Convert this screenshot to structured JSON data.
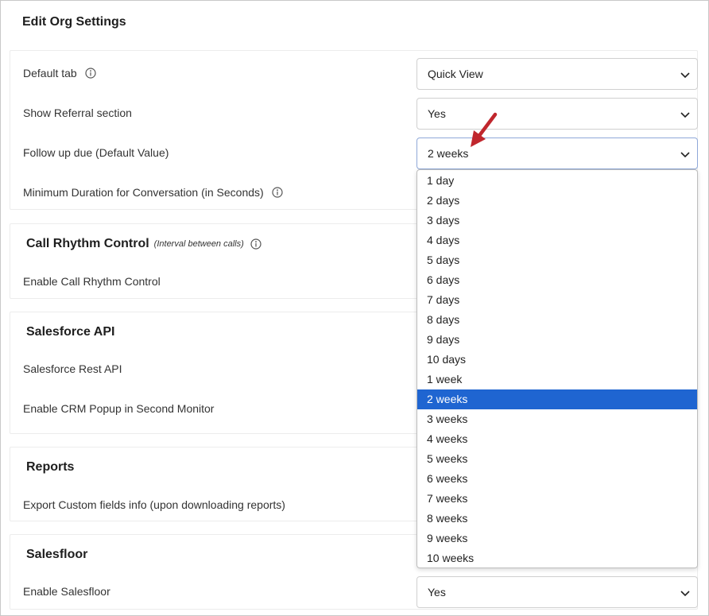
{
  "page": {
    "title": "Edit Org Settings"
  },
  "general": {
    "default_tab": {
      "label": "Default tab",
      "value": "Quick View"
    },
    "referral": {
      "label": "Show Referral section",
      "value": "Yes"
    },
    "follow_up": {
      "label": "Follow up due (Default Value)",
      "value": "2 weeks"
    },
    "min_duration": {
      "label": "Minimum Duration for Conversation (in Seconds)"
    }
  },
  "call_rhythm": {
    "heading": "Call Rhythm Control",
    "subheading": "(Interval between calls)",
    "enable_label": "Enable Call Rhythm Control"
  },
  "salesforce": {
    "heading": "Salesforce API",
    "rest_label": "Salesforce Rest API",
    "crm_popup_label": "Enable CRM Popup in Second Monitor"
  },
  "reports": {
    "heading": "Reports",
    "export_label": "Export Custom fields info (upon downloading reports)"
  },
  "salesfloor": {
    "heading": "Salesfloor",
    "enable_label": "Enable Salesfloor",
    "enable_value": "Yes"
  },
  "follow_up_options": [
    "1 day",
    "2 days",
    "3 days",
    "4 days",
    "5 days",
    "6 days",
    "7 days",
    "8 days",
    "9 days",
    "10 days",
    "1 week",
    "2 weeks",
    "3 weeks",
    "4 weeks",
    "5 weeks",
    "6 weeks",
    "7 weeks",
    "8 weeks",
    "9 weeks",
    "10 weeks"
  ],
  "selected_option": "2 weeks",
  "colors": {
    "selected_bg": "#1f65d1",
    "annotation_arrow": "#c0262d"
  },
  "icons": {
    "info": "info-circle-icon",
    "chevron": "chevron-down-icon",
    "annotation": "red-arrow-icon"
  }
}
